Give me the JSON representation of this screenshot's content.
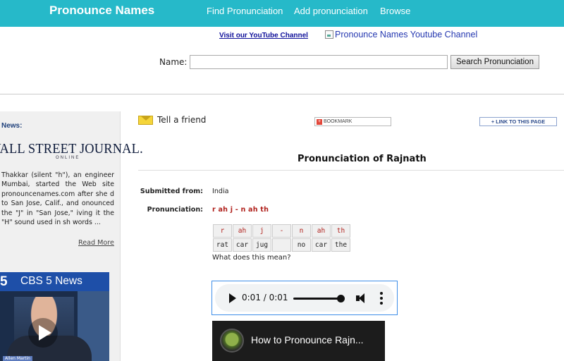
{
  "header": {
    "brand": "Pronounce Names",
    "nav": [
      "Find Pronunciation",
      "Add pronunciation",
      "Browse"
    ]
  },
  "youtube": {
    "link_text": "Visit our YouTube Channel",
    "image_alt": "Pronounce Names Youtube Channel"
  },
  "search": {
    "label": "Name:",
    "value": "",
    "button": "Search Pronunciation"
  },
  "sidebar": {
    "news_label": "News:",
    "newspaper": "WALL STREET JOURNAL.",
    "newspaper_sub": "ONLINE",
    "article": "Thakkar (silent \"h\"), an engineer Mumbai, started the Web site pronouncenames.com after she d to San Jose, Calif., and onounced the \"J\" in \"San Jose,\" iving it the \"H\" sound used in sh words ...",
    "read_more": "Read More",
    "video_channel": "CBS 5 News",
    "video_channel_number": "5",
    "name_plate": "Allen Martin"
  },
  "actions": {
    "tell_friend": "Tell a friend",
    "bookmark": "BOOKMARK",
    "link_page": "LINK TO THIS PAGE"
  },
  "pronunciation": {
    "title": "Pronunciation of Rajnath",
    "submitted_label": "Submitted from:",
    "submitted_value": "India",
    "pron_label": "Pronunciation:",
    "pron_value": "r ah j - n ah th",
    "sounds": [
      "r",
      "ah",
      "j",
      "-",
      "n",
      "ah",
      "th"
    ],
    "examples": [
      "rat",
      "car",
      "jug",
      "",
      "no",
      "car",
      "the"
    ],
    "what_means": "What does this mean?"
  },
  "audio": {
    "time": "0:01 / 0:01",
    "progress": 1.0
  },
  "video": {
    "title": "How to Pronounce Rajn..."
  },
  "colors": {
    "topbar": "#26b9c9",
    "pron_red": "#b0211c",
    "link_blue": "#10119a"
  }
}
